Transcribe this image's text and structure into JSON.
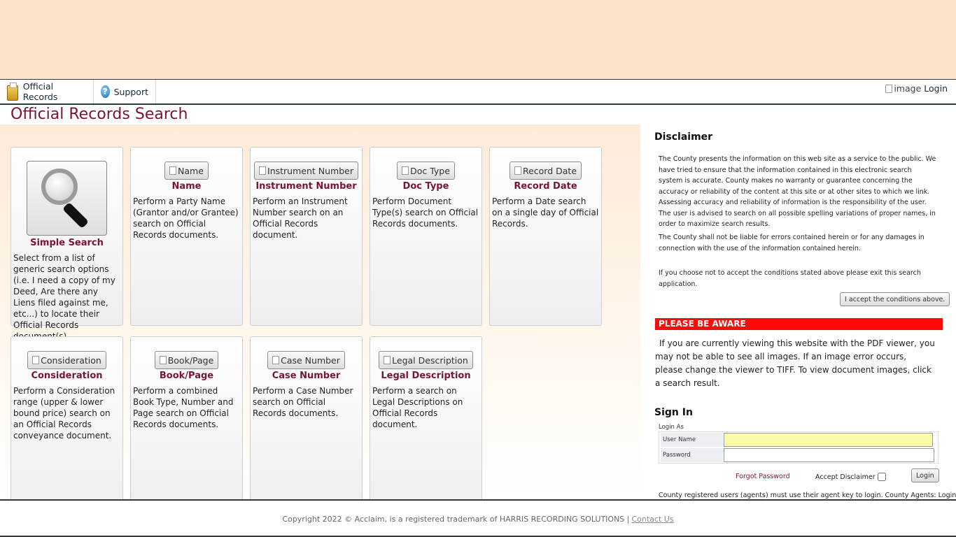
{
  "navbar": {
    "official_records": "Official Records",
    "support": "Support",
    "login_alt": "image",
    "login": "Login"
  },
  "page_title": "Official Records Search",
  "cards": [
    {
      "button": "",
      "title": "Simple Search",
      "desc": "Select from a list of generic search options (i.e. I need a copy of my Deed, Are there any Liens filed against me, etc...) to locate their Official Records document(s)."
    },
    {
      "button": "Name",
      "title": "Name",
      "desc": "Perform a Party Name (Grantor and/or Grantee) search on Official Records documents."
    },
    {
      "button": "Instrument Number",
      "title": "Instrument Number",
      "desc": "Perform an Instrument Number search on an Official Records document."
    },
    {
      "button": "Doc Type",
      "title": "Doc Type",
      "desc": "Perform Document Type(s) search on Official Records documents."
    },
    {
      "button": "Record Date",
      "title": "Record Date",
      "desc": "Perform a Date search on a single day of Official Records."
    },
    {
      "button": "Consideration",
      "title": "Consideration",
      "desc": "Perform a Consideration range (upper & lower bound price) search on an Official Records conveyance document."
    },
    {
      "button": "Book/Page",
      "title": "Book/Page",
      "desc": "Perform a combined Book Type, Number and Page search on Official Records documents."
    },
    {
      "button": "Case Number",
      "title": "Case Number",
      "desc": "Perform a Case Number search on Official Records documents."
    },
    {
      "button": "Legal Description",
      "title": "Legal Description",
      "desc": "Perform a search on Legal Descriptions on Official Records document."
    }
  ],
  "disclaimer": {
    "title": "Disclaimer",
    "p1": "The County presents the information on this web site as a service to the public. We have tried to ensure that the information contained in this electronic search system is accurate. County makes no warranty or guarantee concerning the accuracy or reliability of the content at this site or at other sites to which we link. Assessing accuracy and reliability of information is the responsibility of the user. The user is advised to search on all possible spelling variations of proper names, in order to maximize search results.",
    "p2": "The County shall not be liable for errors contained herein or for any damages in connection with the use of the information contained herein.",
    "p3": "If you choose not to accept the conditions stated above please exit this search application.",
    "accept_button": "I accept the conditions above."
  },
  "aware": {
    "title": "PLEASE BE AWARE",
    "text": "If you are currently viewing this website with the PDF viewer, you may not be able to see all images. If an image error occurs, please change the viewer to TIFF. To view document images, click a search result."
  },
  "signin": {
    "title": "Sign In",
    "login_as": "Login As",
    "username_label": "User Name",
    "password_label": "Password",
    "username_value": "",
    "password_value": "",
    "forgot": "Forgot Password",
    "accept_disclaimer": "Accept Disclaimer",
    "login_button": "Login",
    "agents_note": "County registered users (agents) must use their agent key to login. County Agents: Login"
  },
  "footer": {
    "copyright": "Copyright 2022 © Acclaim, is a registered trademark of HARRIS RECORDING SOLUTIONS |",
    "contact": "Contact Us"
  },
  "colors": {
    "banner": "#fde4c8",
    "title_accent": "#7a1432",
    "aware_red": "#ff0a0a",
    "username_highlight": "#fbfba9"
  }
}
